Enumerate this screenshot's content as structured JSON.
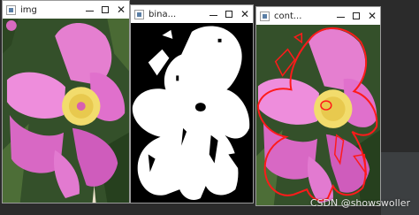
{
  "windows": [
    {
      "title": "img",
      "controls": {
        "minimize": "—",
        "maximize": "□",
        "close": "✕"
      }
    },
    {
      "title": "bina...",
      "controls": {
        "minimize": "—",
        "maximize": "□",
        "close": "✕"
      }
    },
    {
      "title": "cont...",
      "controls": {
        "minimize": "—",
        "maximize": "□",
        "close": "✕"
      }
    }
  ],
  "watermark": "CSDN @showswoller",
  "colors": {
    "petal": "#e878d2",
    "petal_dark": "#c94fb0",
    "stamen": "#f2dc6c",
    "foliage": "#3a5a2c",
    "contour": "#ff1a1a",
    "binary_fg": "#ffffff",
    "binary_bg": "#000000"
  }
}
